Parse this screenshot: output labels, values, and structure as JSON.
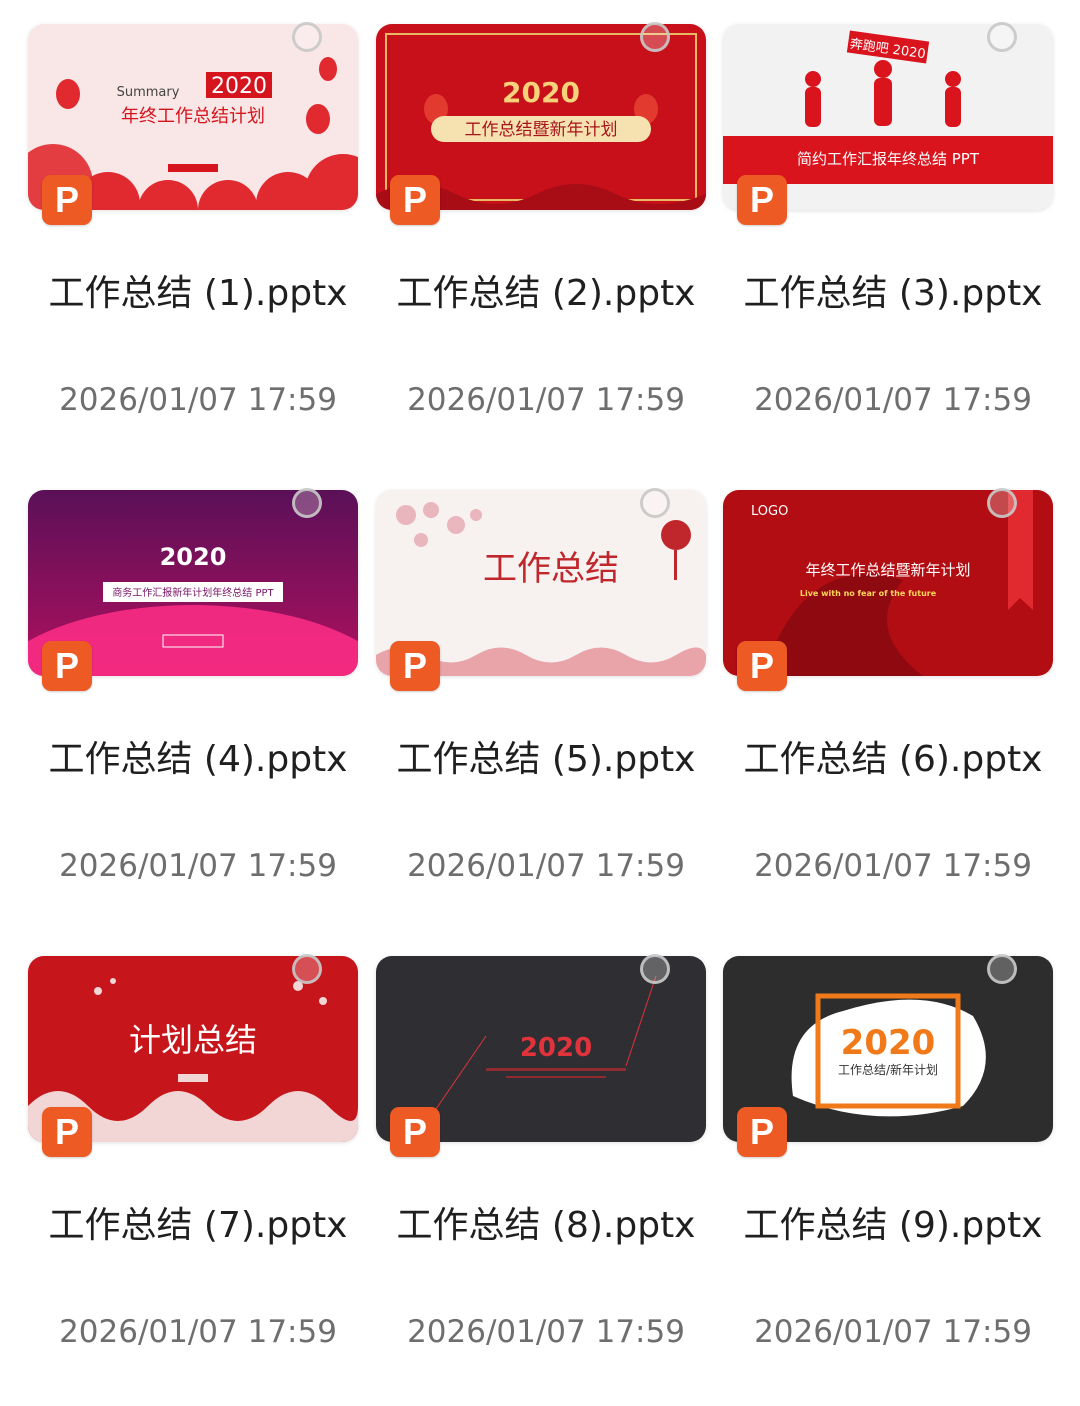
{
  "files": [
    {
      "name": "工作总结 (1).pptx",
      "date": "2026/01/07 17:59",
      "thumb": {
        "year": "2020",
        "title": "年终工作总结计划",
        "sub": "Summary",
        "bg": "#f9e6e6",
        "accent": "#d6141d"
      }
    },
    {
      "name": "工作总结 (2).pptx",
      "date": "2026/01/07 17:59",
      "thumb": {
        "year": "2020",
        "title": "工作总结暨新年计划",
        "bg": "#c8101a",
        "accent": "#f6d27a"
      }
    },
    {
      "name": "工作总结 (3).pptx",
      "date": "2026/01/07 17:59",
      "thumb": {
        "year": "奔跑吧 2020",
        "title": "简约工作汇报年终总结 PPT",
        "bg": "#f2f2f2",
        "accent": "#d9141d"
      }
    },
    {
      "name": "工作总结 (4).pptx",
      "date": "2026/01/07 17:59",
      "thumb": {
        "year": "2020",
        "title": "商务工作汇报新年计划年终总结 PPT",
        "bg": "#6a1060",
        "accent": "#ff3b8b"
      }
    },
    {
      "name": "工作总结 (5).pptx",
      "date": "2026/01/07 17:59",
      "thumb": {
        "year": "",
        "title": "工作总结",
        "bg": "#f7f1ef",
        "accent": "#c0272d"
      }
    },
    {
      "name": "工作总结 (6).pptx",
      "date": "2026/01/07 17:59",
      "thumb": {
        "year": "LOGO",
        "title": "年终工作总结暨新年计划",
        "sub": "Live with no fear of the future",
        "bg": "#b10d12",
        "accent": "#ffd65a"
      }
    },
    {
      "name": "工作总结 (7).pptx",
      "date": "2026/01/07 17:59",
      "thumb": {
        "year": "",
        "title": "计划总结",
        "bg": "#c7151c",
        "accent": "#ffffff"
      }
    },
    {
      "name": "工作总结 (8).pptx",
      "date": "2026/01/07 17:59",
      "thumb": {
        "year": "2020",
        "title": "",
        "bg": "#2f2f33",
        "accent": "#e0333c"
      }
    },
    {
      "name": "工作总结 (9).pptx",
      "date": "2026/01/07 17:59",
      "thumb": {
        "year": "2020",
        "title": "工作总结/新年计划",
        "bg": "#2d2d2d",
        "accent": "#f07a1a"
      }
    }
  ],
  "icon": {
    "ppt_letter": "P",
    "color": "#ee5a24"
  }
}
